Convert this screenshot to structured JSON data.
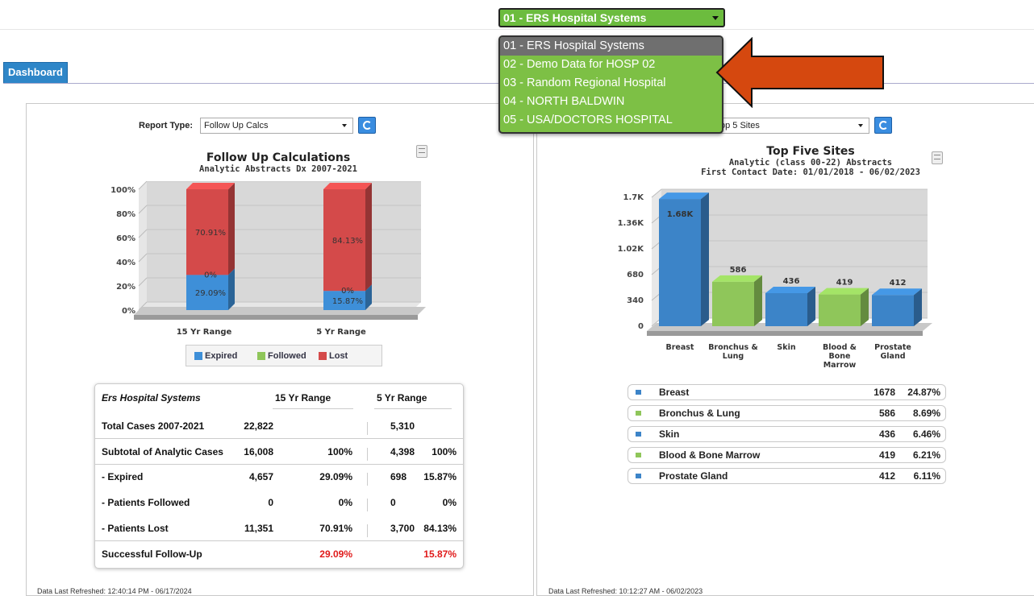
{
  "hospital_selector": {
    "selected": "01 - ERS Hospital Systems",
    "options": [
      "01 - ERS Hospital Systems",
      "02 - Demo Data for HOSP 02",
      "03 - Random Regional Hospital",
      "04 - NORTH BALDWIN",
      "05 - USA/DOCTORS HOSPITAL"
    ]
  },
  "tabs": {
    "dashboard": "Dashboard"
  },
  "left": {
    "report_type_label": "Report Type:",
    "report_type_value": "Follow Up Calcs",
    "chart_title": "Follow Up Calculations",
    "chart_subtitle": "Analytic Abstracts Dx 2007-2021",
    "legend": [
      "Expired",
      "Followed",
      "Lost"
    ],
    "table": {
      "title": "Ers Hospital Systems",
      "col1": "15 Yr Range",
      "col2": "5 Yr Range",
      "rows": [
        {
          "label": "Total Cases 2007-2021",
          "a": "22,822",
          "ap": "",
          "b": "5,310",
          "bp": ""
        },
        {
          "label": "Subtotal of Analytic Cases",
          "a": "16,008",
          "ap": "100%",
          "b": "4,398",
          "bp": "100%"
        },
        {
          "label": "- Expired",
          "a": "4,657",
          "ap": "29.09%",
          "b": "698",
          "bp": "15.87%"
        },
        {
          "label": "- Patients Followed",
          "a": "0",
          "ap": "0%",
          "b": "0",
          "bp": "0%"
        },
        {
          "label": "- Patients Lost",
          "a": "11,351",
          "ap": "70.91%",
          "b": "3,700",
          "bp": "84.13%"
        },
        {
          "label": "Successful Follow-Up",
          "a": "",
          "ap": "29.09%",
          "b": "",
          "bp": "15.87%"
        }
      ]
    },
    "refreshed": "Data Last Refreshed: 12:40:14 PM - 06/17/2024"
  },
  "right": {
    "report_type_value": "Top 5 Sites",
    "report_type_visible": "op 5 Sites",
    "chart_title": "Top Five Sites",
    "chart_subtitle1": "Analytic (class 00-22) Abstracts",
    "chart_subtitle2": "First Contact Date: 01/01/2018 - 06/02/2023",
    "sites": [
      {
        "name": "Breast",
        "count": "1678",
        "pct": "24.87%",
        "color": "#3c84c8"
      },
      {
        "name": "Bronchus & Lung",
        "count": "586",
        "pct": "8.69%",
        "color": "#8fc65a"
      },
      {
        "name": "Skin",
        "count": "436",
        "pct": "6.46%",
        "color": "#3c84c8"
      },
      {
        "name": "Blood & Bone Marrow",
        "count": "419",
        "pct": "6.21%",
        "color": "#8fc65a"
      },
      {
        "name": "Prostate Gland",
        "count": "412",
        "pct": "6.11%",
        "color": "#3c84c8"
      }
    ],
    "refreshed": "Data Last Refreshed: 10:12:27 AM - 06/02/2023"
  },
  "colors": {
    "expired": "#3e8fd8",
    "followed": "#8fc65a",
    "lost": "#d44a4a",
    "annotation_arrow": "#d5480f"
  },
  "chart_data": [
    {
      "type": "bar",
      "stacked": true,
      "title": "Follow Up Calculations",
      "subtitle": "Analytic Abstracts Dx 2007-2021",
      "categories": [
        "15 Yr Range",
        "5 Yr Range"
      ],
      "series": [
        {
          "name": "Expired",
          "values": [
            29.09,
            15.87
          ],
          "labels": [
            "29.09%",
            "15.87%"
          ]
        },
        {
          "name": "Followed",
          "values": [
            0,
            0
          ],
          "labels": [
            "0%",
            "0%"
          ]
        },
        {
          "name": "Lost",
          "values": [
            70.91,
            84.13
          ],
          "labels": [
            "70.91%",
            "84.13%"
          ]
        }
      ],
      "y_ticks": [
        "0%",
        "20%",
        "40%",
        "60%",
        "80%",
        "100%"
      ],
      "ylim": [
        0,
        100
      ]
    },
    {
      "type": "bar",
      "title": "Top Five Sites",
      "subtitle": "Analytic (class 00-22) Abstracts First Contact Date: 01/01/2018 - 06/02/2023",
      "categories": [
        "Breast",
        "Bronchus & Lung",
        "Skin",
        "Blood & Bone Marrow",
        "Prostate Gland"
      ],
      "category_labels": [
        [
          "Breast"
        ],
        [
          "Bronchus &",
          "Lung"
        ],
        [
          "Skin"
        ],
        [
          "Blood &",
          "Bone",
          "Marrow"
        ],
        [
          "Prostate",
          "Gland"
        ]
      ],
      "values": [
        1678,
        586,
        436,
        419,
        412
      ],
      "value_labels": [
        "1.68K",
        "586",
        "436",
        "419",
        "412"
      ],
      "y_ticks": [
        "0",
        "340",
        "680",
        "1.02K",
        "1.36K",
        "1.7K"
      ],
      "ylim": [
        0,
        1700
      ]
    }
  ]
}
